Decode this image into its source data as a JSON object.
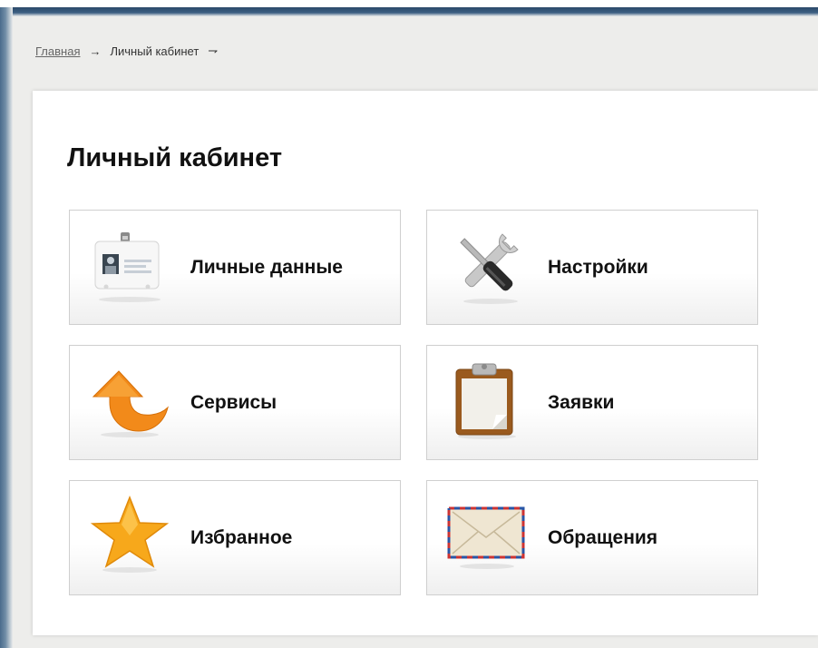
{
  "breadcrumb": {
    "home": "Главная",
    "arrow": "→",
    "current": "Личный кабинет",
    "end_arrow": "⇁"
  },
  "page": {
    "title": "Личный кабинет"
  },
  "tiles": [
    {
      "label": "Личные данные",
      "icon": "id-badge-icon"
    },
    {
      "label": "Настройки",
      "icon": "tools-icon"
    },
    {
      "label": "Сервисы",
      "icon": "arrow-icon"
    },
    {
      "label": "Заявки",
      "icon": "clipboard-icon"
    },
    {
      "label": "Избранное",
      "icon": "star-icon"
    },
    {
      "label": "Обращения",
      "icon": "envelope-icon"
    }
  ],
  "colors": {
    "orange": "#f28a1a",
    "star": "#f7a81b",
    "clipboard": "#9a5a1e",
    "frame_blue": "#3c5f82"
  }
}
